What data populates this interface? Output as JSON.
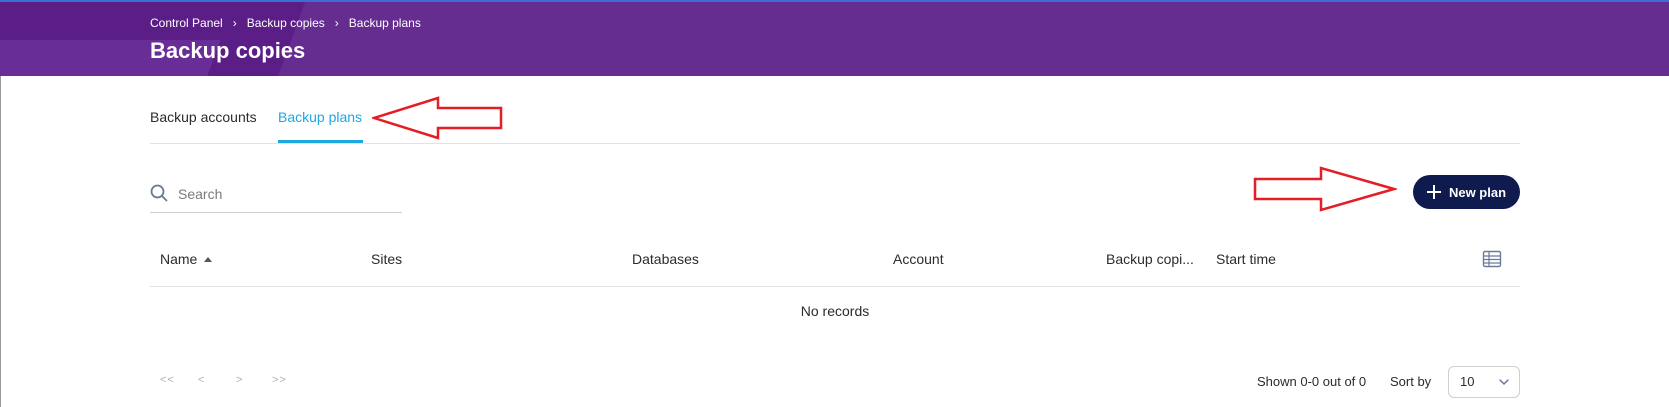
{
  "breadcrumb": {
    "items": [
      "Control Panel",
      "Backup copies",
      "Backup plans"
    ]
  },
  "header": {
    "title": "Backup copies"
  },
  "tabs": [
    {
      "label": "Backup accounts",
      "active": false
    },
    {
      "label": "Backup plans",
      "active": true
    }
  ],
  "search": {
    "placeholder": "Search",
    "value": ""
  },
  "toolbar": {
    "new_plan_label": "New plan"
  },
  "table": {
    "columns": [
      {
        "label": "Name",
        "sort": "ascending"
      },
      {
        "label": "Sites"
      },
      {
        "label": "Databases"
      },
      {
        "label": "Account"
      },
      {
        "label": "Backup copi..."
      },
      {
        "label": "Start time"
      }
    ],
    "rows": [],
    "empty_text": "No records"
  },
  "pagination": {
    "first": "<<",
    "prev": "<",
    "next": ">",
    "last": ">>",
    "shown_text": "Shown 0-0 out of 0",
    "sort_by_label": "Sort by",
    "page_size": "10"
  },
  "colors": {
    "header_bg": "#652d90",
    "accent_tab": "#1ea7e1",
    "primary_button": "#0f1a4e",
    "annotation_arrow": "#e31e24"
  },
  "icons": {
    "search": "search-icon",
    "plus": "plus-icon",
    "column_settings": "table-columns-icon",
    "chevron": "chevron-down-icon"
  }
}
